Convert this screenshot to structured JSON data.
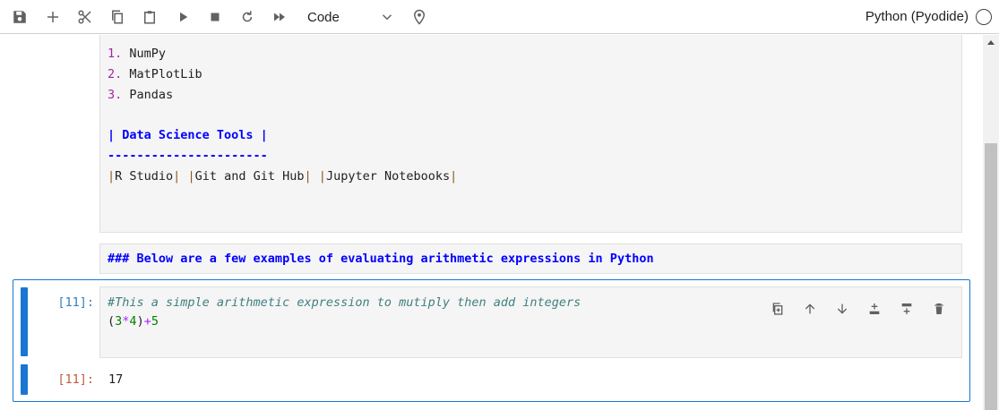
{
  "toolbar": {
    "icons": [
      "save-icon",
      "add-icon",
      "cut-icon",
      "copy-icon",
      "paste-icon",
      "run-icon",
      "stop-icon",
      "restart-icon",
      "fast-forward-icon",
      "chevron-down-icon",
      "location-icon"
    ],
    "cell_type": "Code",
    "kernel": "Python (Pyodide)"
  },
  "markdown_source": {
    "list_numbers": [
      "1.",
      "2.",
      "3."
    ],
    "list_items": [
      "NumPy",
      "MatPlotLib",
      "Pandas"
    ],
    "table_header": "| Data Science Tools |",
    "table_separator": "----------------------",
    "table_row": [
      {
        "open": "|",
        "text": "R Studio",
        "close": "|"
      },
      {
        "open": "|",
        "text": "Git and Git Hub",
        "close": "|"
      },
      {
        "open": "|",
        "text": "Jupyter Notebooks",
        "close": "|"
      }
    ]
  },
  "markdown_cell2": {
    "text": "### Below are a few examples of evaluating arithmetic expressions in Python"
  },
  "code_cell": {
    "in_prompt": "[11]:",
    "comment": "#This a simple arithmetic expression to mutiply then add integers",
    "expr": {
      "open": "(",
      "a": "3",
      "op1": "*",
      "b": "4",
      "close": ")",
      "op2": "+",
      "c": "5"
    },
    "out_prompt": "[11]:",
    "output": "17",
    "tools": [
      "duplicate-icon",
      "move-up-icon",
      "move-down-icon",
      "insert-above-icon",
      "insert-below-icon",
      "delete-icon"
    ]
  },
  "colors": {
    "accent": "#1976d2",
    "list_number": "#a626a4",
    "markdown_header": "#0000ff",
    "comment": "#408080",
    "in_prompt": "#307fc1",
    "out_prompt": "#bf5b3d"
  }
}
